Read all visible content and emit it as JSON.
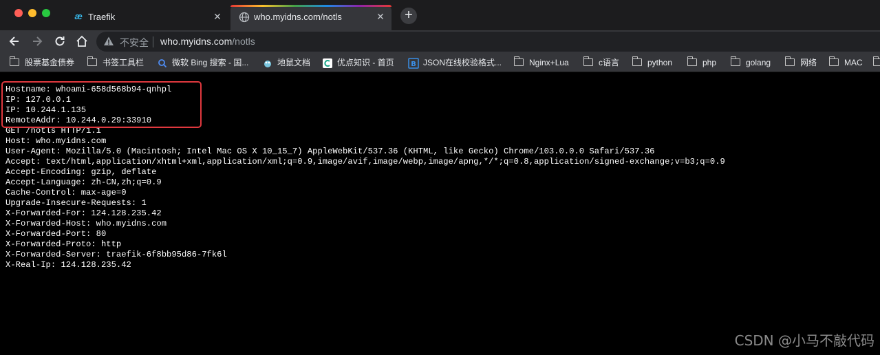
{
  "tabs": [
    {
      "title": "Traefik",
      "favicon": "traefik-icon",
      "active": false
    },
    {
      "title": "who.myidns.com/notls",
      "favicon": "globe-icon",
      "active": true
    }
  ],
  "toolbar": {
    "security_label": "不安全",
    "url_host": "who.myidns.com",
    "url_path": "/notls"
  },
  "bookmarks": [
    {
      "label": "股票基金债券",
      "icon": "folder-icon"
    },
    {
      "label": "书签工具栏",
      "icon": "folder-icon"
    },
    {
      "label": "微软 Bing 搜索 - 国...",
      "icon": "search-icon"
    },
    {
      "label": "地鼠文档",
      "icon": "gopher-icon"
    },
    {
      "label": "优点知识 - 首页",
      "icon": "youdian-icon"
    },
    {
      "label": "JSON在线校验格式...",
      "icon": "json-icon"
    },
    {
      "label": "Nginx+Lua",
      "icon": "folder-icon"
    },
    {
      "label": "c语言",
      "icon": "folder-icon"
    },
    {
      "label": "python",
      "icon": "folder-icon"
    },
    {
      "label": "php",
      "icon": "folder-icon"
    },
    {
      "label": "golang",
      "icon": "folder-icon"
    },
    {
      "label": "网络",
      "icon": "folder-icon"
    },
    {
      "label": "MAC",
      "icon": "folder-icon"
    }
  ],
  "content": {
    "lines": [
      "Hostname: whoami-658d568b94-qnhpl",
      "IP: 127.0.0.1",
      "IP: 10.244.1.135",
      "RemoteAddr: 10.244.0.29:33910",
      "GET /notls HTTP/1.1",
      "Host: who.myidns.com",
      "User-Agent: Mozilla/5.0 (Macintosh; Intel Mac OS X 10_15_7) AppleWebKit/537.36 (KHTML, like Gecko) Chrome/103.0.0.0 Safari/537.36",
      "Accept: text/html,application/xhtml+xml,application/xml;q=0.9,image/avif,image/webp,image/apng,*/*;q=0.8,application/signed-exchange;v=b3;q=0.9",
      "Accept-Encoding: gzip, deflate",
      "Accept-Language: zh-CN,zh;q=0.9",
      "Cache-Control: max-age=0",
      "Upgrade-Insecure-Requests: 1",
      "X-Forwarded-For: 124.128.235.42",
      "X-Forwarded-Host: who.myidns.com",
      "X-Forwarded-Port: 80",
      "X-Forwarded-Proto: http",
      "X-Forwarded-Server: traefik-6f8bb95d86-7fk6l",
      "X-Real-Ip: 124.128.235.42"
    ]
  },
  "watermark": "CSDN @小马不敲代码",
  "colors": {
    "highlight_border": "#e0383e",
    "page_background": "#000000",
    "chrome_toolbar": "#35363a"
  }
}
